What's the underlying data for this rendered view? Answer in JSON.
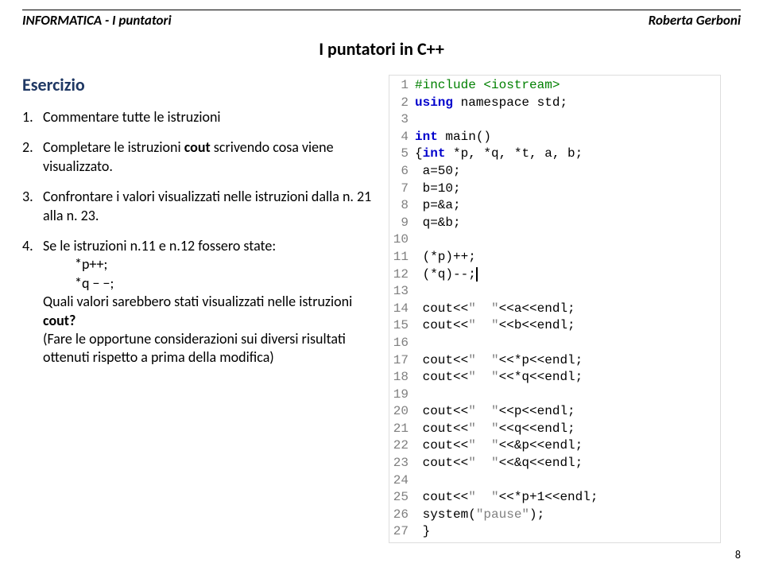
{
  "header": {
    "left": "INFORMATICA - I puntatori",
    "right": "Roberta Gerboni"
  },
  "title": "I puntatori in  C++",
  "exercise": {
    "label": "Esercizio",
    "item1": {
      "num": "1.",
      "text": "Commentare tutte le istruzioni"
    },
    "item2": {
      "num": "2.",
      "part_a": "Completare le istruzioni ",
      "bold": "cout ",
      "part_b": "scrivendo cosa viene visualizzato."
    },
    "item3": {
      "num": "3.",
      "text": "Confrontare i valori visualizzati nelle istruzioni dalla n. 21 alla n. 23."
    },
    "item4": {
      "num": "4.",
      "line_a": "Se le istruzioni n.11 e n.12 fossero state:",
      "sub_a": "*p++;",
      "sub_b": "*q − −;",
      "line_b_a": "Quali valori sarebbero stati visualizzati nelle istruzioni  ",
      "line_b_bold": "cout?",
      "line_c": "(Fare le opportune considerazioni sui diversi risultati ottenuti rispetto a prima della modifica)"
    }
  },
  "code": {
    "lines": [
      {
        "n": "1",
        "type": "pre",
        "text": "#include <iostream>"
      },
      {
        "n": "2",
        "type": "kw",
        "text_a": "using",
        "text_b": " namespace std;"
      },
      {
        "n": "3",
        "type": "plain",
        "text": ""
      },
      {
        "n": "4",
        "type": "kw",
        "text_a": "int",
        "text_b": " main()"
      },
      {
        "n": "5",
        "type": "kw2",
        "text_a": "{",
        "text_b": "int",
        "text_c": " *p, *q, *t, a, b;"
      },
      {
        "n": "6",
        "type": "plain",
        "text": " a=50;"
      },
      {
        "n": "7",
        "type": "plain",
        "text": " b=10;"
      },
      {
        "n": "8",
        "type": "plain",
        "text": " p=&a;"
      },
      {
        "n": "9",
        "type": "plain",
        "text": " q=&b;"
      },
      {
        "n": "10",
        "type": "plain",
        "text": ""
      },
      {
        "n": "11",
        "type": "plain",
        "text": " (*p)++;"
      },
      {
        "n": "12",
        "type": "cursor",
        "text": " (*q)--;"
      },
      {
        "n": "13",
        "type": "plain",
        "text": ""
      },
      {
        "n": "14",
        "type": "cout",
        "str": "\"  \"",
        "tail": "<<a<<endl;"
      },
      {
        "n": "15",
        "type": "cout",
        "str": "\"  \"",
        "tail": "<<b<<endl;"
      },
      {
        "n": "16",
        "type": "plain",
        "text": ""
      },
      {
        "n": "17",
        "type": "cout",
        "str": "\"  \"",
        "tail": "<<*p<<endl;"
      },
      {
        "n": "18",
        "type": "cout",
        "str": "\"  \"",
        "tail": "<<*q<<endl;"
      },
      {
        "n": "19",
        "type": "plain",
        "text": ""
      },
      {
        "n": "20",
        "type": "cout",
        "str": "\"  \"",
        "tail": "<<p<<endl;"
      },
      {
        "n": "21",
        "type": "cout",
        "str": "\"  \"",
        "tail": "<<q<<endl;"
      },
      {
        "n": "22",
        "type": "cout",
        "str": "\"  \"",
        "tail": "<<&p<<endl;"
      },
      {
        "n": "23",
        "type": "cout",
        "str": "\"  \"",
        "tail": "<<&q<<endl;"
      },
      {
        "n": "24",
        "type": "plain",
        "text": ""
      },
      {
        "n": "25",
        "type": "cout",
        "str": "\"  \"",
        "tail": "<<*p+1<<endl;"
      },
      {
        "n": "26",
        "type": "sys",
        "text_a": " system(",
        "str": "\"pause\"",
        "text_b": ");"
      },
      {
        "n": "27",
        "type": "plain",
        "text": " }"
      }
    ]
  },
  "page": "8"
}
